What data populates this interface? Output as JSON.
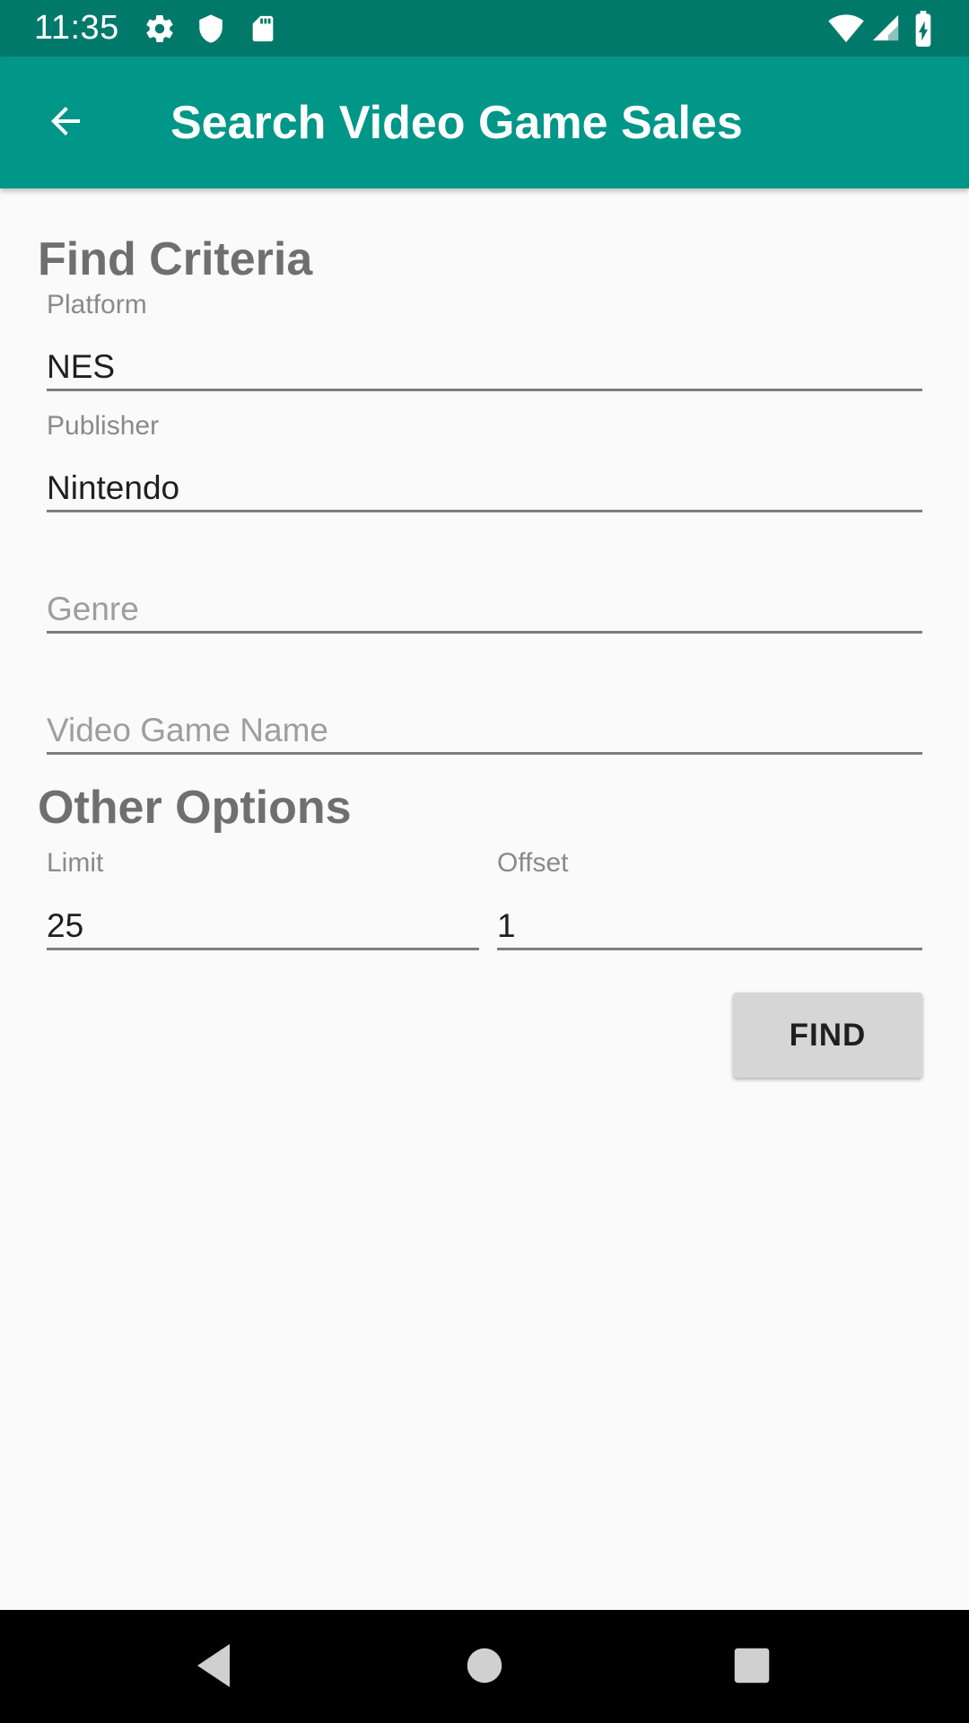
{
  "status_bar": {
    "time": "11:35",
    "icons": [
      "gear-icon",
      "shield-icon",
      "sd-card-icon",
      "wifi-icon",
      "cell-signal-icon",
      "battery-charging-icon"
    ]
  },
  "app_bar": {
    "title": "Search Video Game Sales",
    "back_icon": "arrow-back-icon"
  },
  "find_criteria": {
    "heading": "Find Criteria",
    "platform": {
      "label": "Platform",
      "value": "NES"
    },
    "publisher": {
      "label": "Publisher",
      "value": "Nintendo"
    },
    "genre": {
      "placeholder": "Genre",
      "value": ""
    },
    "video_game_name": {
      "placeholder": "Video Game Name",
      "value": ""
    }
  },
  "other_options": {
    "heading": "Other Options",
    "limit": {
      "label": "Limit",
      "value": "25"
    },
    "offset": {
      "label": "Offset",
      "value": "1"
    }
  },
  "find_button": {
    "label": "FIND"
  },
  "nav_bar": {
    "icons": [
      "nav-back-icon",
      "nav-home-icon",
      "nav-recents-icon"
    ]
  },
  "colors": {
    "status_bar": "#00796b",
    "app_bar": "#009688",
    "background": "#fafafa",
    "heading_text": "#6f6f6f",
    "button_bg": "#d6d6d6"
  }
}
